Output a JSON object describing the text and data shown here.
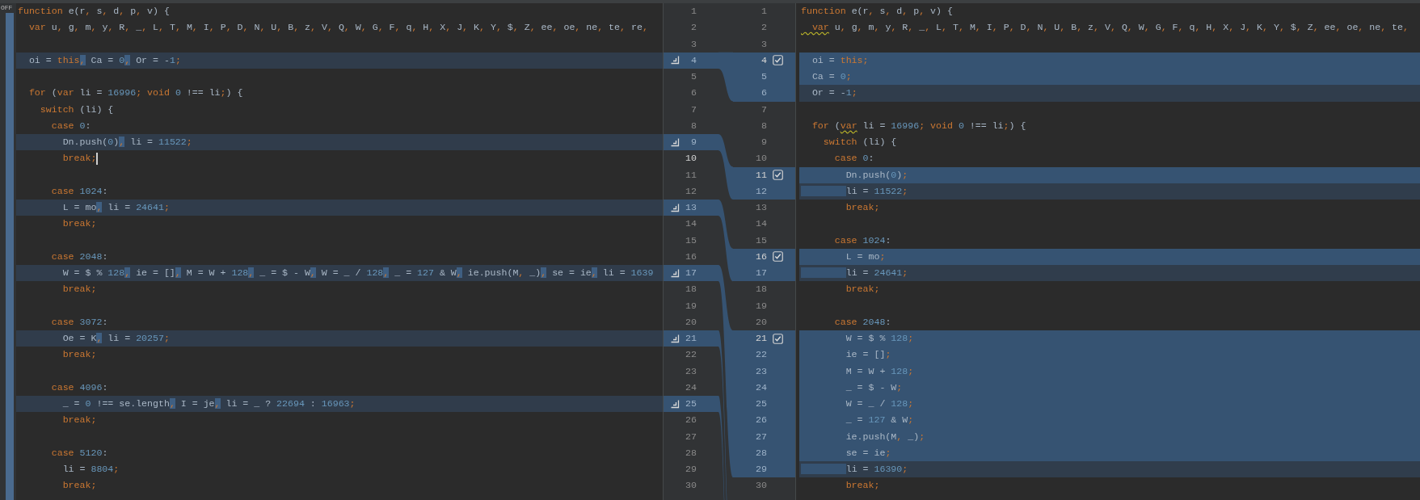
{
  "left_strip": {
    "label": "OFF"
  },
  "left_pane": {
    "lines": [
      {
        "number": "1",
        "modified": false,
        "current": false,
        "tokens": [
          {
            "text": "function",
            "kind": "keyword"
          },
          {
            "text": " e(r, s, d, p, v) {",
            "kind": "code"
          }
        ]
      },
      {
        "number": "2",
        "modified": false,
        "current": false,
        "tokens": [
          {
            "text": "  var",
            "kind": "keyword"
          },
          {
            "text": " u, g, m, y, R, _, L, T, M, I, P, D, N, U, B, z, V, Q, W, G, F, q, H, X, J, K, Y, $, Z, ee, oe, ne, te, re,",
            "kind": "code"
          }
        ]
      },
      {
        "number": "3",
        "modified": false,
        "current": false
      },
      {
        "number": "4",
        "modified": true,
        "current": false,
        "tokens": [
          {
            "text": "  oi = ",
            "kind": "code"
          },
          {
            "text": "this",
            "kind": "keyword"
          },
          {
            "text": ",",
            "kind": "changed"
          },
          {
            "text": " Ca = 0",
            "kind": "code"
          },
          {
            "text": ",",
            "kind": "changed"
          },
          {
            "text": " Or = -1;",
            "kind": "code"
          }
        ]
      },
      {
        "number": "5",
        "modified": false,
        "current": false
      },
      {
        "number": "6",
        "modified": false,
        "current": false,
        "tokens": [
          {
            "text": "  for",
            "kind": "keyword"
          },
          {
            "text": " (",
            "kind": "code"
          },
          {
            "text": "var",
            "kind": "keyword"
          },
          {
            "text": " li = 16996; ",
            "kind": "code"
          },
          {
            "text": "void",
            "kind": "keyword"
          },
          {
            "text": " 0 !== li;) {",
            "kind": "code"
          }
        ]
      },
      {
        "number": "7",
        "modified": false,
        "current": false,
        "tokens": [
          {
            "text": "    switch",
            "kind": "keyword"
          },
          {
            "text": " (li) {",
            "kind": "code"
          }
        ]
      },
      {
        "number": "8",
        "modified": false,
        "current": false,
        "tokens": [
          {
            "text": "      case",
            "kind": "keyword"
          },
          {
            "text": " 0:",
            "kind": "code"
          }
        ]
      },
      {
        "number": "9",
        "modified": true,
        "current": false,
        "tokens": [
          {
            "text": "        Dn.push(0)",
            "kind": "code"
          },
          {
            "text": ",",
            "kind": "changed"
          },
          {
            "text": " li = 11522;",
            "kind": "code"
          }
        ]
      },
      {
        "number": "10",
        "modified": false,
        "current": true,
        "tokens": [
          {
            "text": "        break",
            "kind": "keyword"
          },
          {
            "text": ";",
            "kind": "code"
          }
        ]
      },
      {
        "number": "11",
        "modified": false,
        "current": false
      },
      {
        "number": "12",
        "modified": false,
        "current": false,
        "tokens": [
          {
            "text": "      case",
            "kind": "keyword"
          },
          {
            "text": " 1024:",
            "kind": "code"
          }
        ]
      },
      {
        "number": "13",
        "modified": true,
        "current": false,
        "tokens": [
          {
            "text": "        L = mo",
            "kind": "code"
          },
          {
            "text": ",",
            "kind": "changed"
          },
          {
            "text": " li = 24641;",
            "kind": "code"
          }
        ]
      },
      {
        "number": "14",
        "modified": false,
        "current": false,
        "tokens": [
          {
            "text": "        break",
            "kind": "keyword"
          },
          {
            "text": ";",
            "kind": "code"
          }
        ]
      },
      {
        "number": "15",
        "modified": false,
        "current": false
      },
      {
        "number": "16",
        "modified": false,
        "current": false,
        "tokens": [
          {
            "text": "      case",
            "kind": "keyword"
          },
          {
            "text": " 2048:",
            "kind": "code"
          }
        ]
      },
      {
        "number": "17",
        "modified": true,
        "current": false,
        "tokens": [
          {
            "text": "        W = $ % 128",
            "kind": "code"
          },
          {
            "text": ",",
            "kind": "changed"
          },
          {
            "text": " ie = []",
            "kind": "code"
          },
          {
            "text": ",",
            "kind": "changed"
          },
          {
            "text": " M = W + 128",
            "kind": "code"
          },
          {
            "text": ",",
            "kind": "changed"
          },
          {
            "text": " _ = $ - W",
            "kind": "code"
          },
          {
            "text": ",",
            "kind": "changed"
          },
          {
            "text": " W = _ / 128",
            "kind": "code"
          },
          {
            "text": ",",
            "kind": "changed"
          },
          {
            "text": " _ = 127 & W",
            "kind": "code"
          },
          {
            "text": ",",
            "kind": "changed"
          },
          {
            "text": " ie.push(M, _)",
            "kind": "code"
          },
          {
            "text": ",",
            "kind": "changed"
          },
          {
            "text": " se = ie",
            "kind": "code"
          },
          {
            "text": ",",
            "kind": "changed"
          },
          {
            "text": " li = 1639",
            "kind": "code"
          }
        ]
      },
      {
        "number": "18",
        "modified": false,
        "current": false,
        "tokens": [
          {
            "text": "        break",
            "kind": "keyword"
          },
          {
            "text": ";",
            "kind": "code"
          }
        ]
      },
      {
        "number": "19",
        "modified": false,
        "current": false
      },
      {
        "number": "20",
        "modified": false,
        "current": false,
        "tokens": [
          {
            "text": "      case",
            "kind": "keyword"
          },
          {
            "text": " 3072:",
            "kind": "code"
          }
        ]
      },
      {
        "number": "21",
        "modified": true,
        "current": false,
        "tokens": [
          {
            "text": "        Oe = K",
            "kind": "code"
          },
          {
            "text": ",",
            "kind": "changed"
          },
          {
            "text": " li = 20257;",
            "kind": "code"
          }
        ]
      },
      {
        "number": "22",
        "modified": false,
        "current": false,
        "tokens": [
          {
            "text": "        break",
            "kind": "keyword"
          },
          {
            "text": ";",
            "kind": "code"
          }
        ]
      },
      {
        "number": "23",
        "modified": false,
        "current": false
      },
      {
        "number": "24",
        "modified": false,
        "current": false,
        "tokens": [
          {
            "text": "      case",
            "kind": "keyword"
          },
          {
            "text": " 4096:",
            "kind": "code"
          }
        ]
      },
      {
        "number": "25",
        "modified": true,
        "current": false,
        "tokens": [
          {
            "text": "        _ = 0 !== se.length",
            "kind": "code"
          },
          {
            "text": ",",
            "kind": "changed"
          },
          {
            "text": " I = je",
            "kind": "code"
          },
          {
            "text": ",",
            "kind": "changed"
          },
          {
            "text": " li = _ ? 22694 : 16963;",
            "kind": "code"
          }
        ]
      },
      {
        "number": "26",
        "modified": false,
        "current": false,
        "tokens": [
          {
            "text": "        break",
            "kind": "keyword"
          },
          {
            "text": ";",
            "kind": "code"
          }
        ]
      },
      {
        "number": "27",
        "modified": false,
        "current": false
      },
      {
        "number": "28",
        "modified": false,
        "current": false,
        "tokens": [
          {
            "text": "      case",
            "kind": "keyword"
          },
          {
            "text": " 5120:",
            "kind": "code"
          }
        ]
      },
      {
        "number": "29",
        "modified": false,
        "current": false,
        "tokens": [
          {
            "text": "        li = 8804;",
            "kind": "code"
          }
        ]
      },
      {
        "number": "30",
        "modified": false,
        "current": false,
        "tokens": [
          {
            "text": "        break",
            "kind": "keyword"
          },
          {
            "text": ";",
            "kind": "code"
          }
        ]
      }
    ]
  },
  "right_pane": {
    "lines": [
      {
        "number": "1",
        "kind": "unchanged",
        "checked": false,
        "tokens": [
          {
            "text": "function",
            "kind": "keyword"
          },
          {
            "text": " e(r, s, d, p, v) {",
            "kind": "code"
          }
        ]
      },
      {
        "number": "2",
        "kind": "unchanged",
        "checked": false,
        "tokens": [
          {
            "text": "  var",
            "kind": "keyword-warning"
          },
          {
            "text": " u, g, m, y, R, _, L, T, M, I, P, D, N, U, B, z, V, Q, W, G, F, q, H, X, J, K, Y, $, Z, ee, oe, ne, te,",
            "kind": "code"
          }
        ]
      },
      {
        "number": "3",
        "kind": "unchanged",
        "checked": false
      },
      {
        "number": "4",
        "kind": "inserted",
        "checked": true,
        "tokens": [
          {
            "text": "  oi = ",
            "kind": "code"
          },
          {
            "text": "this",
            "kind": "keyword"
          },
          {
            "text": ";",
            "kind": "code"
          }
        ]
      },
      {
        "number": "5",
        "kind": "inserted",
        "checked": false,
        "tokens": [
          {
            "text": "  Ca = 0;",
            "kind": "code"
          }
        ]
      },
      {
        "number": "6",
        "kind": "modified",
        "checked": false,
        "tokens": [
          {
            "text": "  Or = -1;",
            "kind": "code"
          }
        ]
      },
      {
        "number": "7",
        "kind": "unchanged",
        "checked": false
      },
      {
        "number": "8",
        "kind": "unchanged",
        "checked": false,
        "tokens": [
          {
            "text": "  for",
            "kind": "keyword"
          },
          {
            "text": " (",
            "kind": "code"
          },
          {
            "text": "var",
            "kind": "keyword-warning"
          },
          {
            "text": " li = 16996; ",
            "kind": "code"
          },
          {
            "text": "void",
            "kind": "keyword"
          },
          {
            "text": " 0 !== li;) {",
            "kind": "code"
          }
        ]
      },
      {
        "number": "9",
        "kind": "unchanged",
        "checked": false,
        "tokens": [
          {
            "text": "    switch",
            "kind": "keyword"
          },
          {
            "text": " (li) {",
            "kind": "code"
          }
        ]
      },
      {
        "number": "10",
        "kind": "unchanged",
        "checked": false,
        "tokens": [
          {
            "text": "      case",
            "kind": "keyword"
          },
          {
            "text": " 0:",
            "kind": "code"
          }
        ]
      },
      {
        "number": "11",
        "kind": "inserted",
        "checked": true,
        "tokens": [
          {
            "text": "        Dn.push(0);",
            "kind": "code"
          }
        ]
      },
      {
        "number": "12",
        "kind": "modified",
        "checked": false,
        "tokens": [
          {
            "text": "        li = 11522;",
            "kind": "indent-changed"
          }
        ]
      },
      {
        "number": "13",
        "kind": "unchanged",
        "checked": false,
        "tokens": [
          {
            "text": "        break",
            "kind": "keyword"
          },
          {
            "text": ";",
            "kind": "code"
          }
        ]
      },
      {
        "number": "14",
        "kind": "unchanged",
        "checked": false
      },
      {
        "number": "15",
        "kind": "unchanged",
        "checked": false,
        "tokens": [
          {
            "text": "      case",
            "kind": "keyword"
          },
          {
            "text": " 1024:",
            "kind": "code"
          }
        ]
      },
      {
        "number": "16",
        "kind": "inserted",
        "checked": true,
        "tokens": [
          {
            "text": "        L = mo;",
            "kind": "code"
          }
        ]
      },
      {
        "number": "17",
        "kind": "modified",
        "checked": false,
        "tokens": [
          {
            "text": "        li = 24641;",
            "kind": "indent-changed"
          }
        ]
      },
      {
        "number": "18",
        "kind": "unchanged",
        "checked": false,
        "tokens": [
          {
            "text": "        break",
            "kind": "keyword"
          },
          {
            "text": ";",
            "kind": "code"
          }
        ]
      },
      {
        "number": "19",
        "kind": "unchanged",
        "checked": false
      },
      {
        "number": "20",
        "kind": "unchanged",
        "checked": false,
        "tokens": [
          {
            "text": "      case",
            "kind": "keyword"
          },
          {
            "text": " 2048:",
            "kind": "code"
          }
        ]
      },
      {
        "number": "21",
        "kind": "inserted",
        "checked": true,
        "tokens": [
          {
            "text": "        W = $ % 128;",
            "kind": "code"
          }
        ]
      },
      {
        "number": "22",
        "kind": "inserted",
        "checked": false,
        "tokens": [
          {
            "text": "        ie = [];",
            "kind": "code"
          }
        ]
      },
      {
        "number": "23",
        "kind": "inserted",
        "checked": false,
        "tokens": [
          {
            "text": "        M = W + 128;",
            "kind": "code"
          }
        ]
      },
      {
        "number": "24",
        "kind": "inserted",
        "checked": false,
        "tokens": [
          {
            "text": "        _ = $ - W;",
            "kind": "code"
          }
        ]
      },
      {
        "number": "25",
        "kind": "inserted",
        "checked": false,
        "tokens": [
          {
            "text": "        W = _ / 128;",
            "kind": "code"
          }
        ]
      },
      {
        "number": "26",
        "kind": "inserted",
        "checked": false,
        "tokens": [
          {
            "text": "        _ = 127 & W;",
            "kind": "code"
          }
        ]
      },
      {
        "number": "27",
        "kind": "inserted",
        "checked": false,
        "tokens": [
          {
            "text": "        ie.push(M, _);",
            "kind": "code"
          }
        ]
      },
      {
        "number": "28",
        "kind": "inserted",
        "checked": false,
        "tokens": [
          {
            "text": "        se = ie;",
            "kind": "code"
          }
        ]
      },
      {
        "number": "29",
        "kind": "modified",
        "checked": false,
        "tokens": [
          {
            "text": "        li = 16390;",
            "kind": "indent-changed"
          }
        ]
      },
      {
        "number": "30",
        "kind": "unchanged",
        "checked": false,
        "tokens": [
          {
            "text": "        break",
            "kind": "keyword"
          },
          {
            "text": ";",
            "kind": "code"
          }
        ]
      }
    ]
  }
}
